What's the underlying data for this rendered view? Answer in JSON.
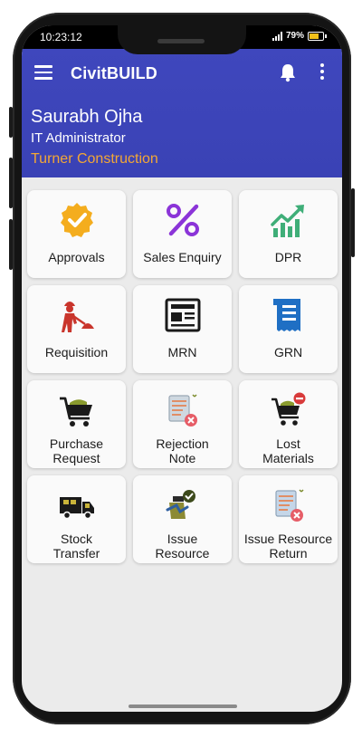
{
  "status_bar": {
    "time": "10:23:12",
    "battery": "79%"
  },
  "app_bar": {
    "title": "CivitBUILD"
  },
  "user": {
    "name": "Saurabh Ojha",
    "role": "IT Administrator",
    "company": "Turner Construction"
  },
  "colors": {
    "header": "#3f47bd",
    "company": "#f3a735",
    "tile": "#fafafa",
    "screen": "#ebebeb"
  },
  "tiles": [
    {
      "line1": "Approvals",
      "line2": "",
      "icon": "approval-badge-icon"
    },
    {
      "line1": "Sales Enquiry",
      "line2": "",
      "icon": "percent-icon"
    },
    {
      "line1": "DPR",
      "line2": "",
      "icon": "growth-chart-icon"
    },
    {
      "line1": "Requisition",
      "line2": "",
      "icon": "worker-shovel-icon"
    },
    {
      "line1": "MRN",
      "line2": "",
      "icon": "newspaper-icon"
    },
    {
      "line1": "GRN",
      "line2": "",
      "icon": "receipt-icon"
    },
    {
      "line1": "Purchase",
      "line2": "Request",
      "icon": "shopping-cart-icon"
    },
    {
      "line1": "Rejection",
      "line2": "Note",
      "icon": "rejected-document-icon"
    },
    {
      "line1": "Lost",
      "line2": "Materials",
      "icon": "cart-remove-icon"
    },
    {
      "line1": "Stock",
      "line2": "Transfer",
      "icon": "delivery-truck-icon"
    },
    {
      "line1": "Issue",
      "line2": "Resource",
      "icon": "issue-resource-icon"
    },
    {
      "line1": "Issue Resource",
      "line2": "Return",
      "icon": "resource-return-icon"
    }
  ]
}
